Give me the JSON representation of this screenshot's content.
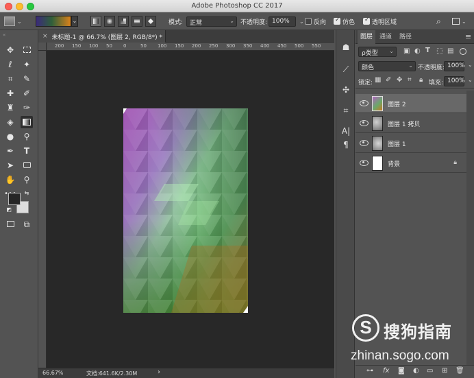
{
  "window": {
    "title": "Adobe Photoshop CC 2017"
  },
  "options": {
    "mode_label": "模式:",
    "mode_value": "正常",
    "opacity_label": "不透明度:",
    "opacity_value": "100%",
    "reverse_label": "反向",
    "dither_label": "仿色",
    "transparency_label": "透明区域",
    "reverse_checked": false,
    "dither_checked": true,
    "transparency_checked": true
  },
  "document": {
    "tab_label": "未标题-1 @ 66.7% (图层 2, RGB/8*) *"
  },
  "ruler": {
    "ticks": [
      "200",
      "150",
      "100",
      "50",
      "0",
      "50",
      "100",
      "150",
      "200",
      "250",
      "300",
      "350",
      "400",
      "450",
      "500",
      "550"
    ]
  },
  "status": {
    "zoom": "66.67%",
    "doc_info": "文档:641.6K/2.30M",
    "arrow": "›"
  },
  "layers_panel": {
    "tabs": [
      "图层",
      "通道",
      "路径"
    ],
    "filter_label": "ρ类型",
    "blend_mode": "颜色",
    "opacity_label": "不透明度:",
    "opacity_value": "100%",
    "lock_label": "锁定:",
    "fill_label": "填充:",
    "fill_value": "100%",
    "layers": [
      {
        "name": "图层 2",
        "selected": true
      },
      {
        "name": "图层 1 拷贝",
        "selected": false
      },
      {
        "name": "图层 1",
        "selected": false
      },
      {
        "name": "背景",
        "selected": false,
        "locked": true
      }
    ],
    "footer_icons": [
      "link-icon",
      "fx-icon",
      "mask-icon",
      "adjustment-icon",
      "folder-icon",
      "new-layer-icon",
      "trash-icon"
    ]
  },
  "watermark": {
    "name": "搜狗指南",
    "url": "zhinan.sogo.com",
    "logo_letter": "S"
  },
  "colors": {
    "foreground": "#262626",
    "background": "#dddddd",
    "app_bg": "#535353",
    "canvas_bg": "#282828"
  }
}
